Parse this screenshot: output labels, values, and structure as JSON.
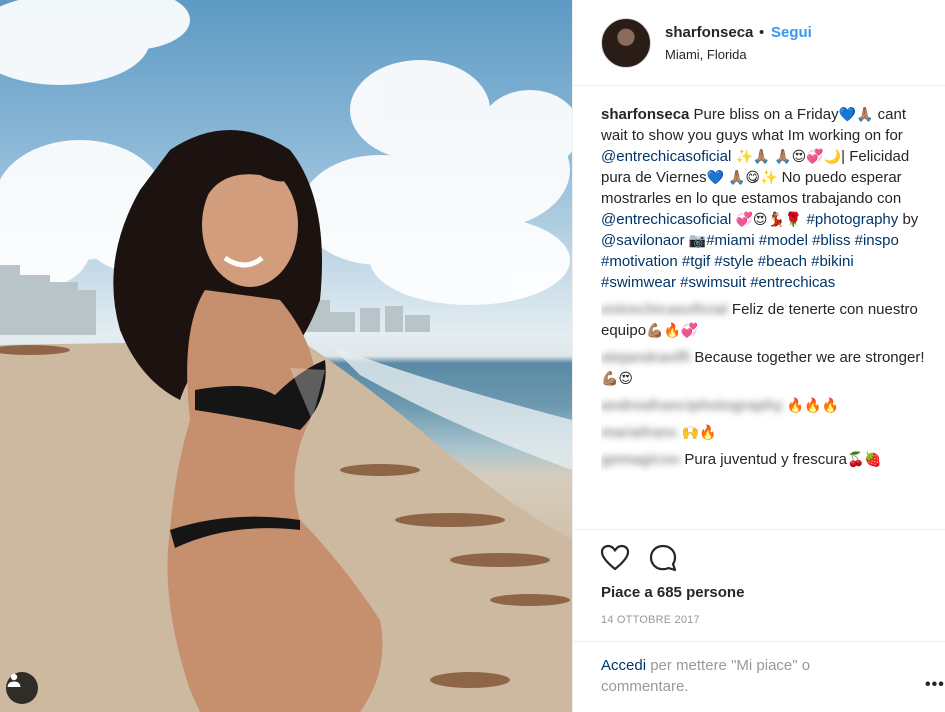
{
  "header": {
    "username": "sharfonseca",
    "dot": "•",
    "follow_label": "Segui",
    "location": "Miami, Florida"
  },
  "caption": {
    "username": "sharfonseca",
    "text_1": "Pure bliss on a Friday",
    "emoji_1": "💙🙏🏽",
    "text_2": "cant wait to show you guys what Im working on for",
    "mention_1": "@entrechicasoficial",
    "emoji_2": "✨🙏🏽 🙏🏽😍💞🌙",
    "text_3": "| Felicidad pura de Viernes",
    "emoji_3": "💙 🙏🏽😋✨",
    "text_4": "No puedo esperar mostrarles en lo que estamos trabajando con",
    "mention_2": "@entrechicasoficial",
    "emoji_4": "💞😍💃🏽🌹",
    "hashtag_photography": "#photography",
    "by_word": "by",
    "mention_3": "@savilonaor",
    "emoji_camera": "📷",
    "hashtags": "#miami #model #bliss #inspo #motivation #tgif #style #beach #bikini #swimwear #swimsuit #entrechicas"
  },
  "comments": [
    {
      "user": "entrechicasoficial",
      "text": "Feliz de tenerte con nuestro equipo",
      "emoji": "💪🏽🔥💞"
    },
    {
      "user": "alejandraoffi",
      "text": "Because together we are stronger!",
      "emoji": "💪🏽😍"
    },
    {
      "user": "andreafranciphotography",
      "text": "",
      "emoji": "🔥🔥🔥"
    },
    {
      "user": "mariafranc",
      "text": "",
      "emoji": "🙌🔥"
    },
    {
      "user": "gemagicoo",
      "text": "Pura juventud y frescura",
      "emoji": "🍒🍓"
    }
  ],
  "actions": {
    "like_icon": "heart-icon",
    "comment_icon": "comment-icon",
    "likes_text": "Piace a 685 persone",
    "date": "14 OTTOBRE 2017"
  },
  "login": {
    "link": "Accedi",
    "text": "per mettere \"Mi piace\" o commentare."
  },
  "more_label": "•••",
  "colors": {
    "link": "#003569",
    "follow": "#3897f0",
    "text": "#262626",
    "muted": "#999999"
  }
}
